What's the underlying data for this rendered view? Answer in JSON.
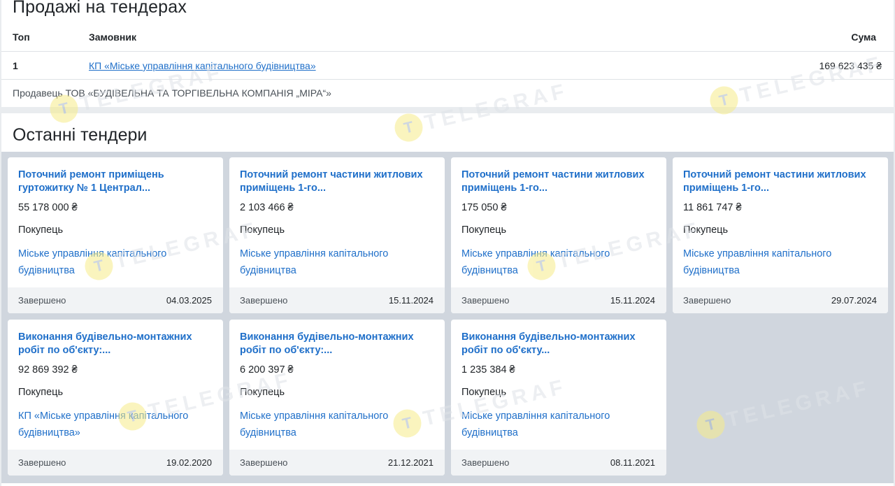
{
  "sales": {
    "title": "Продажі на тендерах",
    "headers": {
      "top": "Топ",
      "customer": "Замовник",
      "sum": "Сума"
    },
    "rows": [
      {
        "rank": "1",
        "customer": "КП «Міське управління капітального будівництва»",
        "sum": "169 623 435 ₴"
      }
    ],
    "seller": "Продавець ТОВ «БУДІВЕЛЬНА ТА ТОРГІВЕЛЬНА КОМПАНІЯ „МІРА“»"
  },
  "recent": {
    "title": "Останні тендери",
    "cards": [
      {
        "title": "Поточний ремонт приміщень гуртожитку № 1 Централ...",
        "sum": "55 178 000 ₴",
        "role": "Покупець",
        "buyer": "Міське управління капітального будівництва",
        "status": "Завершено",
        "date": "04.03.2025"
      },
      {
        "title": "Поточний ремонт частини житлових приміщень 1-го...",
        "sum": "2 103 466 ₴",
        "role": "Покупець",
        "buyer": "Міське управління капітального будівництва",
        "status": "Завершено",
        "date": "15.11.2024"
      },
      {
        "title": "Поточний ремонт частини житлових приміщень 1-го...",
        "sum": "175 050 ₴",
        "role": "Покупець",
        "buyer": "Міське управління капітального будівництва",
        "status": "Завершено",
        "date": "15.11.2024"
      },
      {
        "title": "Поточний ремонт частини житлових приміщень 1-го...",
        "sum": "11 861 747 ₴",
        "role": "Покупець",
        "buyer": "Міське управління капітального будівництва",
        "status": "Завершено",
        "date": "29.07.2024"
      },
      {
        "title": "Виконання будівельно-монтажних робіт по об'єкту:...",
        "sum": "92 869 392 ₴",
        "role": "Покупець",
        "buyer": "КП «Міське управління капітального будівництва»",
        "status": "Завершено",
        "date": "19.02.2020"
      },
      {
        "title": "Виконання будівельно-монтажних робіт по об'єкту:...",
        "sum": "6 200 397 ₴",
        "role": "Покупець",
        "buyer": "Міське управління капітального будівництва",
        "status": "Завершено",
        "date": "21.12.2021"
      },
      {
        "title": "Виконання будівельно-монтажних робіт по об'єкту...",
        "sum": "1 235 384 ₴",
        "role": "Покупець",
        "buyer": "Міське управління капітального будівництва",
        "status": "Завершено",
        "date": "08.11.2021"
      }
    ]
  },
  "watermark": {
    "text": "TELEGRAF",
    "icon": "telegraf-logo-icon"
  },
  "colors": {
    "link": "#1f6fc9",
    "grid_background": "#d0d6de",
    "card_footer": "#f1f3f5",
    "watermark_circle": "#f7ec8a"
  }
}
